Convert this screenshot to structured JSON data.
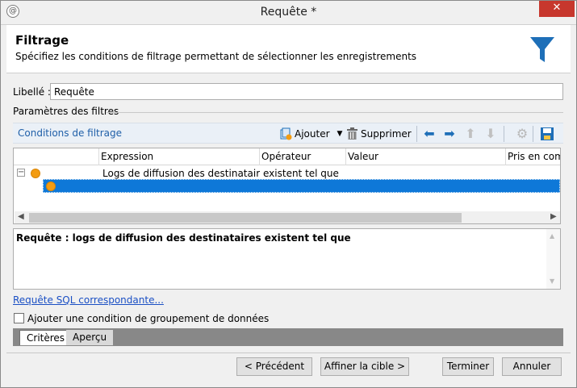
{
  "window": {
    "title": "Requête *",
    "close_glyph": "✕"
  },
  "header": {
    "title": "Filtrage",
    "subtitle": "Spécifiez les conditions de filtrage permettant de sélectionner les enregistrements",
    "icon": "funnel-icon"
  },
  "form": {
    "libelle_label": "Libellé :",
    "libelle_value": "Requête",
    "section_label": "Paramètres des filtres"
  },
  "toolbar": {
    "title": "Conditions de filtrage",
    "add_label": "Ajouter",
    "delete_label": "Supprimer"
  },
  "grid": {
    "columns": [
      "Expression",
      "Opérateur",
      "Valeur",
      "Pris en comp"
    ],
    "rows": [
      {
        "expression": "Logs de diffusion des destinataires ...",
        "operator": "existent tel que",
        "value": ""
      }
    ]
  },
  "summary_text": "Requête : logs de diffusion des destinataires existent tel que",
  "sql_link": "Requête SQL correspondante...",
  "group_checkbox_label": "Ajouter une condition de groupement de données",
  "tabs": [
    "Critères",
    "Aperçu"
  ],
  "buttons": {
    "previous": "< Précédent",
    "refine": "Affiner la cible >",
    "finish": "Terminer",
    "cancel": "Annuler"
  },
  "colors": {
    "accent_blue": "#1f5fa8",
    "funnel": "#1e6fb8",
    "node_orange": "#f39c12",
    "selection": "#0e78d8",
    "close": "#c7372d"
  }
}
